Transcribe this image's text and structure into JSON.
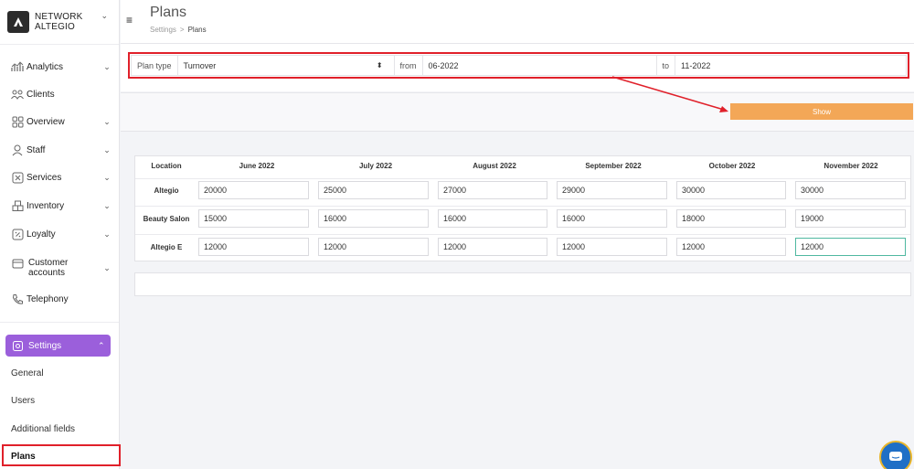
{
  "brand": {
    "line1": "NETWORK",
    "line2": "ALTEGIO"
  },
  "sidebar": {
    "items": [
      {
        "label": "Analytics",
        "icon": "analytics-icon",
        "chevron": true
      },
      {
        "label": "Clients",
        "icon": "clients-icon",
        "chevron": false
      },
      {
        "label": "Overview",
        "icon": "overview-icon",
        "chevron": true
      },
      {
        "label": "Staff",
        "icon": "staff-icon",
        "chevron": true
      },
      {
        "label": "Services",
        "icon": "services-icon",
        "chevron": true
      },
      {
        "label": "Inventory",
        "icon": "inventory-icon",
        "chevron": true
      },
      {
        "label": "Loyalty",
        "icon": "loyalty-icon",
        "chevron": true
      },
      {
        "label": "Customer accounts",
        "icon": "wallet-icon",
        "chevron": true
      },
      {
        "label": "Telephony",
        "icon": "phone-icon",
        "chevron": false
      }
    ],
    "settings": {
      "label": "Settings",
      "icon": "gear-icon",
      "color": "#9b5fdb"
    },
    "sub_items": [
      "General",
      "Users",
      "Additional fields",
      "Plans"
    ]
  },
  "header": {
    "title": "Plans",
    "breadcrumb": {
      "parent": "Settings",
      "separator": ">",
      "current": "Plans"
    }
  },
  "filters": {
    "plan_type_label": "Plan type",
    "plan_type_value": "Turnover",
    "from_label": "from",
    "from_value": "06-2022",
    "to_label": "to",
    "to_value": "11-2022"
  },
  "show_button": {
    "label": "Show",
    "color": "#f3a757"
  },
  "table": {
    "columns": [
      "Location",
      "June 2022",
      "July 2022",
      "August 2022",
      "September 2022",
      "October 2022",
      "November 2022"
    ],
    "rows": [
      {
        "location": "Altegio",
        "values": [
          "20000",
          "25000",
          "27000",
          "29000",
          "30000",
          "30000"
        ]
      },
      {
        "location": "Beauty Salon",
        "values": [
          "15000",
          "16000",
          "16000",
          "16000",
          "18000",
          "19000"
        ]
      },
      {
        "location": "Altegio E",
        "values": [
          "12000",
          "12000",
          "12000",
          "12000",
          "12000",
          "12000"
        ]
      }
    ]
  },
  "annotation_color": "#e0202a"
}
